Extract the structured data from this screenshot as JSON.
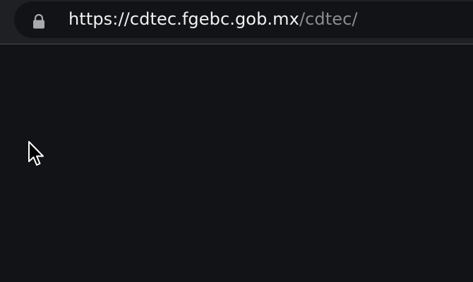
{
  "browser": {
    "address_bar": {
      "url_host": "https://cdtec.fgebc.gob.mx",
      "url_path": "/cdtec/",
      "security_icon": "lock-icon"
    }
  },
  "page": {
    "content": ""
  },
  "pointer": {
    "icon": "mouse-pointer-icon"
  },
  "colors": {
    "toolbar_background": "#1f2023",
    "omnibox_background": "#121316",
    "page_background": "#121316",
    "url_host_text": "#f1f1f3",
    "url_path_text": "#8b8c90"
  }
}
